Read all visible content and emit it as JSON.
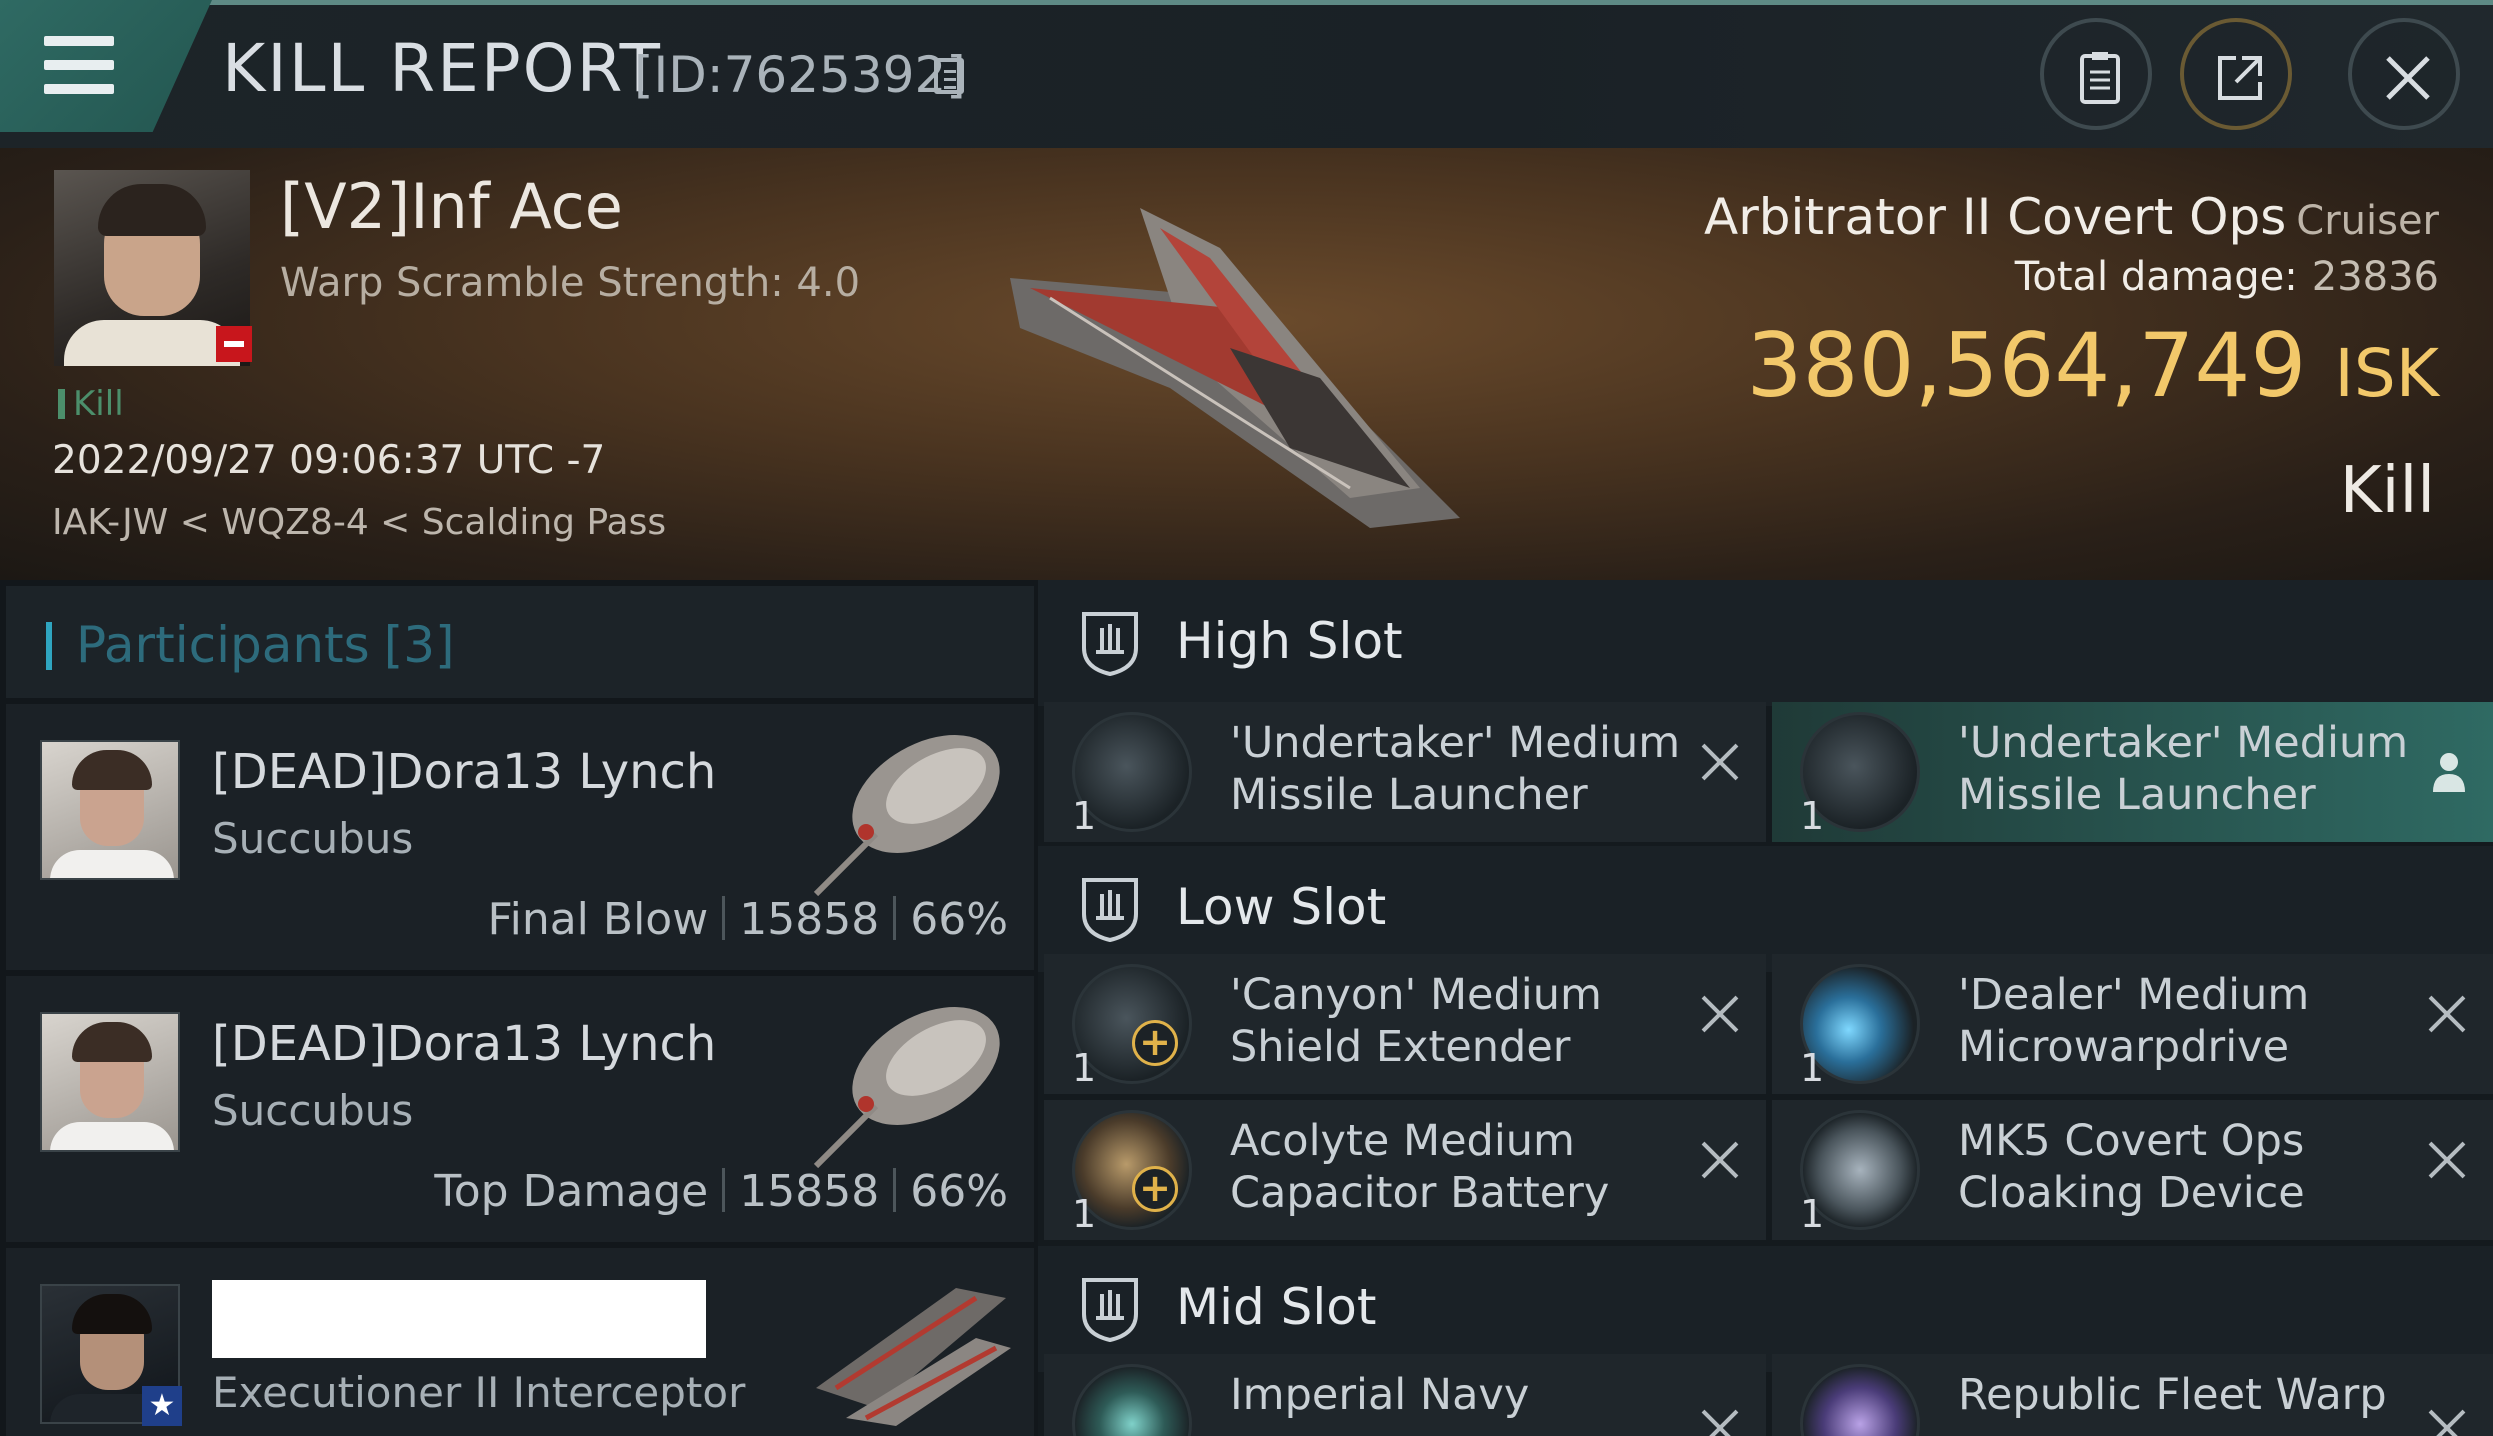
{
  "header": {
    "title": "KILL REPORT",
    "report_id": "[ID:7625392]",
    "buttons": [
      "clipboard",
      "share",
      "close"
    ]
  },
  "victim": {
    "name": "[V2]Inf Ace",
    "warp_scramble": "Warp Scramble Strength: 4.0",
    "tag": "Kill",
    "datetime": "2022/09/27 09:06:37 UTC -7",
    "location": "IAK-JW < WQZ8-4 < Scalding Pass",
    "ship_name": "Arbitrator II Covert Ops",
    "ship_class": "Cruiser",
    "damage_label": "Total damage:",
    "damage_value": "23836",
    "isk_value": "380,564,749",
    "isk_unit": "ISK",
    "result": "Kill"
  },
  "participants": {
    "title": "Participants",
    "count": "[3]",
    "items": [
      {
        "name": "[DEAD]Dora13 Lynch",
        "ship": "Succubus",
        "role": "Final Blow",
        "damage": "15858",
        "percent": "66%"
      },
      {
        "name": "[DEAD]Dora13 Lynch",
        "ship": "Succubus",
        "role": "Top Damage",
        "damage": "15858",
        "percent": "66%"
      },
      {
        "name": "",
        "ship": "Executioner II Interceptor"
      }
    ]
  },
  "slots": {
    "high": {
      "title": "High Slot",
      "modules": [
        {
          "line1": "'Undertaker' Medium",
          "line2": "Missile Launcher",
          "qty": "1",
          "icon": "missile-launcher-icon"
        },
        {
          "line1": "'Undertaker' Medium",
          "line2": "Missile Launcher",
          "qty": "1",
          "icon": "missile-launcher-icon"
        }
      ]
    },
    "low": {
      "title": "Low Slot",
      "modules": [
        {
          "line1": "'Canyon' Medium",
          "line2": "Shield Extender",
          "qty": "1",
          "icon": "shield-extender-icon"
        },
        {
          "line1": "'Dealer' Medium",
          "line2": "Microwarpdrive",
          "qty": "1",
          "icon": "microwarpdrive-icon"
        },
        {
          "line1": "Acolyte Medium",
          "line2": "Capacitor Battery",
          "qty": "1",
          "icon": "capacitor-battery-icon"
        },
        {
          "line1": "MK5 Covert Ops",
          "line2": "Cloaking Device",
          "qty": "1",
          "icon": "cloaking-device-icon"
        }
      ]
    },
    "mid": {
      "title": "Mid Slot",
      "modules": [
        {
          "line1": "Imperial Navy",
          "icon": "navy-module-icon"
        },
        {
          "line1": "Republic Fleet Warp",
          "icon": "warp-module-icon"
        }
      ]
    }
  },
  "colors": {
    "accent_teal": "#2f6a63",
    "isk_gold": "#f2c86a",
    "kill_green": "#4c8f6b",
    "status_red": "#c8161c"
  }
}
